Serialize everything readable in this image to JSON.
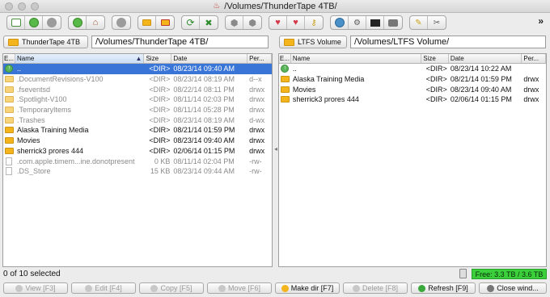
{
  "window": {
    "title": "/Volumes/ThunderTape 4TB/"
  },
  "toolbar": {
    "more_label": "»",
    "groups": [
      [
        "new-window-icon",
        "go-icon",
        "stop-icon"
      ],
      [
        "go-up-icon",
        "home-icon"
      ],
      [
        "record-icon"
      ],
      [
        "new-folder-icon",
        "delete-folder-icon"
      ],
      [
        "refresh-icon",
        "tools-icon"
      ],
      [
        "hexagon-icon",
        "swap-icon"
      ],
      [
        "heart-icon",
        "favorite-icon",
        "key-icon"
      ],
      [
        "globe-icon",
        "link-icon",
        "terminal-icon",
        "message-icon"
      ],
      [
        "settings-icon",
        "help-icon"
      ]
    ]
  },
  "left": {
    "drive_label": "ThunderTape 4TB",
    "path": "/Volumes/ThunderTape 4TB/",
    "columns": {
      "ext": "E...",
      "name": "Name",
      "size": "Size",
      "date": "Date",
      "perm": "Per..."
    },
    "rows": [
      {
        "icon": "up",
        "name": "..",
        "size": "<DIR>",
        "date": "08/23/14 09:40 AM",
        "perm": "",
        "selected": true,
        "dim": false
      },
      {
        "icon": "folder-light",
        "name": ".DocumentRevisions-V100",
        "size": "<DIR>",
        "date": "08/23/14 08:19 AM",
        "perm": "d--x",
        "selected": false,
        "dim": true
      },
      {
        "icon": "folder-light",
        "name": ".fseventsd",
        "size": "<DIR>",
        "date": "08/22/14 08:11 PM",
        "perm": "drwx",
        "selected": false,
        "dim": true
      },
      {
        "icon": "folder-light",
        "name": ".Spotlight-V100",
        "size": "<DIR>",
        "date": "08/11/14 02:03 PM",
        "perm": "drwx",
        "selected": false,
        "dim": true
      },
      {
        "icon": "folder-light",
        "name": ".TemporaryItems",
        "size": "<DIR>",
        "date": "08/11/14 05:28 PM",
        "perm": "drwx",
        "selected": false,
        "dim": true
      },
      {
        "icon": "folder-light",
        "name": ".Trashes",
        "size": "<DIR>",
        "date": "08/23/14 08:19 AM",
        "perm": "d-wx",
        "selected": false,
        "dim": true
      },
      {
        "icon": "folder",
        "name": "Alaska Training Media",
        "size": "<DIR>",
        "date": "08/21/14 01:59 PM",
        "perm": "drwx",
        "selected": false,
        "dim": false
      },
      {
        "icon": "folder",
        "name": "Movies",
        "size": "<DIR>",
        "date": "08/23/14 09:40 AM",
        "perm": "drwx",
        "selected": false,
        "dim": false
      },
      {
        "icon": "folder",
        "name": "sherrick3 prores 444",
        "size": "<DIR>",
        "date": "02/06/14 01:15 PM",
        "perm": "drwx",
        "selected": false,
        "dim": false
      },
      {
        "icon": "doc",
        "name": ".com.apple.timem...ine.donotpresent",
        "size": "0 KB",
        "date": "08/11/14 02:04 PM",
        "perm": "-rw-",
        "selected": false,
        "dim": true
      },
      {
        "icon": "doc",
        "name": ".DS_Store",
        "size": "15 KB",
        "date": "08/23/14 09:44 AM",
        "perm": "-rw-",
        "selected": false,
        "dim": true
      }
    ],
    "status": "0 of 10 selected"
  },
  "right": {
    "drive_label": "LTFS Volume",
    "path": "/Volumes/LTFS Volume/",
    "columns": {
      "ext": "E...",
      "name": "Name",
      "size": "Size",
      "date": "Date",
      "perm": "Per..."
    },
    "rows": [
      {
        "icon": "up",
        "name": "..",
        "size": "<DIR>",
        "date": "08/23/14 10:22 AM",
        "perm": "",
        "selected": false,
        "dim": false
      },
      {
        "icon": "folder",
        "name": "Alaska Training Media",
        "size": "<DIR>",
        "date": "08/21/14 01:59 PM",
        "perm": "drwx",
        "selected": false,
        "dim": false
      },
      {
        "icon": "folder",
        "name": "Movies",
        "size": "<DIR>",
        "date": "08/23/14 09:40 AM",
        "perm": "drwx",
        "selected": false,
        "dim": false
      },
      {
        "icon": "folder",
        "name": "sherrick3 prores 444",
        "size": "<DIR>",
        "date": "02/06/14 01:15 PM",
        "perm": "drwx",
        "selected": false,
        "dim": false
      }
    ],
    "free_space": "Free: 3.3 TB / 3.6 TB"
  },
  "function_keys": [
    {
      "name": "view-button",
      "label": "View [F3]",
      "disabled": true
    },
    {
      "name": "edit-button",
      "label": "Edit [F4]",
      "disabled": true
    },
    {
      "name": "copy-button",
      "label": "Copy [F5]",
      "disabled": true
    },
    {
      "name": "move-button",
      "label": "Move [F6]",
      "disabled": true
    },
    {
      "name": "make-dir-button",
      "label": "Make dir [F7]",
      "disabled": false
    },
    {
      "name": "delete-button",
      "label": "Delete [F8]",
      "disabled": true
    },
    {
      "name": "refresh-button",
      "label": "Refresh [F9]",
      "disabled": false
    },
    {
      "name": "close-window-button",
      "label": "Close wind...",
      "disabled": false
    }
  ],
  "colors": {
    "selection": "#3875d7",
    "folder": "#f3b41c",
    "free_space_bg": "#3bcf3b"
  }
}
